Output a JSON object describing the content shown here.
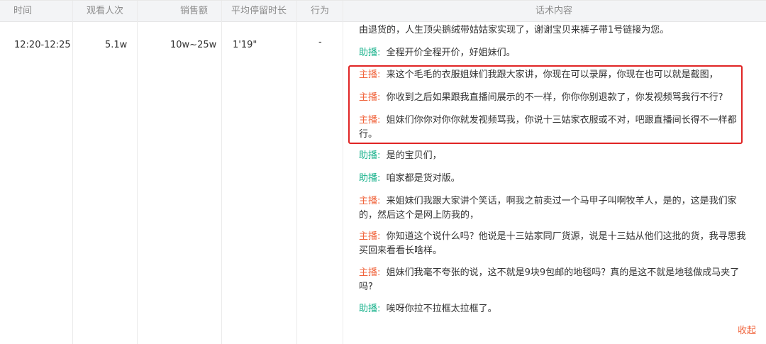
{
  "columns": {
    "time": "时间",
    "viewers": "观看人次",
    "sales": "销售额",
    "avg_stay": "平均停留时长",
    "action": "行为",
    "script": "话术内容"
  },
  "row": {
    "time": "12:20-12:25",
    "viewers": "5.1w",
    "sales": "10w~25w",
    "avg_stay": "1'19\"",
    "action": "-"
  },
  "lines": [
    {
      "speaker": "",
      "role": "none",
      "text": "由退货的，人生顶尖鹅绒带姑姑家实现了，谢谢宝贝来裤子带1号链接为您。"
    },
    {
      "speaker": "助播:",
      "role": "assistant",
      "text": "全程开价全程开价，好姐妹们。"
    },
    {
      "speaker": "主播:",
      "role": "host",
      "text": "来这个毛毛的衣服姐妹们我跟大家讲，你现在可以录屏，你现在也可以就是截图，"
    },
    {
      "speaker": "主播:",
      "role": "host",
      "text": "你收到之后如果跟我直播间展示的不一样，你你你别退款了，你发视频骂我行不行?"
    },
    {
      "speaker": "主播:",
      "role": "host",
      "text": "姐妹们你你对你你就发视频骂我，你说十三姑家衣服或不对，吧跟直播间长得不一样都行。"
    },
    {
      "speaker": "助播:",
      "role": "assistant",
      "text": "是的宝贝们，"
    },
    {
      "speaker": "助播:",
      "role": "assistant",
      "text": "咱家都是货对版。"
    },
    {
      "speaker": "主播:",
      "role": "host",
      "text": "来姐妹们我跟大家讲个笑话，啊我之前卖过一个马甲子叫啊牧羊人，是的，这是我们家的，然后这个是网上防我的，"
    },
    {
      "speaker": "主播:",
      "role": "host",
      "text": "你知道这个说什么吗？他说是十三姑家同厂货源，说是十三姑从他们这批的货，我寻思我买回来看看长啥样。"
    },
    {
      "speaker": "主播:",
      "role": "host",
      "text": "姐妹们我毫不夸张的说，这不就是9块9包邮的地毯吗？真的是这不就是地毯做成马夹了吗?"
    },
    {
      "speaker": "助播:",
      "role": "assistant",
      "text": "唉呀你拉不拉框太拉框了。"
    }
  ],
  "collapse_label": "收起",
  "colors": {
    "host": "#f0643c",
    "assistant": "#19b28c",
    "highlight": "#e02424",
    "header_bg": "#f3f4f6"
  }
}
